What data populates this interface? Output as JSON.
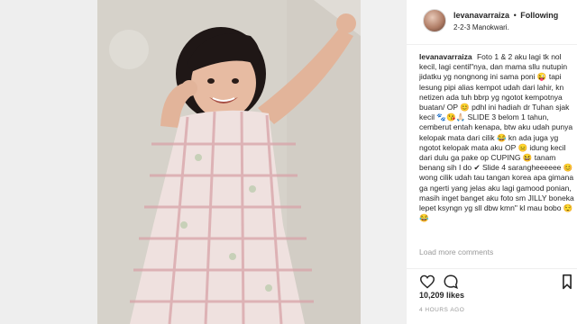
{
  "post": {
    "username": "levanavarraiza",
    "follow_label": "Following",
    "separator": "•",
    "location": "2-2-3 Manokwari.",
    "caption_user": "levanavarraiza",
    "caption_text": "Foto 1 & 2 aku lagi tk nol kecil, lagi centil\"nya, dan mama sllu nutupin jidatku yg nongnong ini sama poni 😜 tapi lesung pipi alias kempot udah dari lahir, kn netizen ada tuh bbrp yg ngotot kempotnya buatan/ OP 😊 pdhl ini hadiah dr Tuhan sjak kecil 🐾😘🙏🏻 SLIDE 3 belom 1 tahun, cemberut entah kenapa, btw aku udah punya kelopak mata dari cilik 😂 kn ada juga yg ngotot kelopak mata aku OP 😑 idung kecil dari dulu ga pake op CUPING 😆 tanam benang sih I do ✔ Slide 4 sarangheeeeee 😊 wong cilik udah tau tangan korea apa gimana ga ngerti yang jelas aku lagi gamood ponian, masih inget banget aku foto sm JILLY boneka lepet ksyngn yg sll dbw kmn\" kl mau bobo 😌😂",
    "load_more": "Load more comments",
    "likes": "10,209 likes",
    "time": "4 HOURS AGO"
  },
  "colors": {
    "text": "#262626",
    "muted": "#999999",
    "divider": "#efefef",
    "background": "#ffffff"
  },
  "icons": [
    "heart-icon",
    "comment-icon",
    "bookmark-icon",
    "avatar"
  ]
}
